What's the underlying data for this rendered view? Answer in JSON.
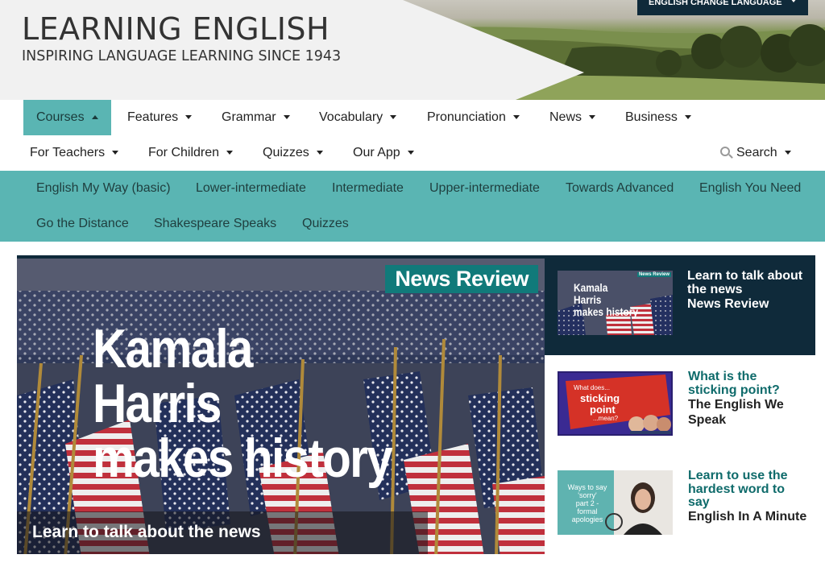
{
  "header": {
    "title": "LEARNING ENGLISH",
    "subtitle": "INSPIRING LANGUAGE LEARNING SINCE 1943",
    "language_button": "ENGLISH CHANGE LANGUAGE"
  },
  "nav": {
    "row1": [
      "Courses",
      "Features",
      "Grammar",
      "Vocabulary",
      "Pronunciation",
      "News",
      "Business"
    ],
    "row2": [
      "For Teachers",
      "For Children",
      "Quizzes",
      "Our App"
    ],
    "search": "Search"
  },
  "subnav": {
    "row1": [
      "English My Way (basic)",
      "Lower-intermediate",
      "Intermediate",
      "Upper-intermediate",
      "Towards Advanced",
      "English You Need"
    ],
    "row2": [
      "Go the Distance",
      "Shakespeare Speaks",
      "Quizzes"
    ]
  },
  "hero": {
    "badge": "News Review",
    "headline_lines": [
      "Kamala",
      "Harris",
      "makes history"
    ],
    "caption": "Learn to talk about the news"
  },
  "cards": [
    {
      "thumb_badge": "News Review",
      "thumb_text": [
        "Kamala",
        "Harris",
        "makes history"
      ],
      "title": "Learn to talk about the news",
      "subtitle": "News Review"
    },
    {
      "thumb_text": [
        "What does...",
        "sticking",
        "point",
        "...mean?"
      ],
      "title": "What is the sticking point?",
      "subtitle": "The English We Speak"
    },
    {
      "thumb_text": [
        "Ways to say",
        "'sorry'",
        "part 2 -",
        "formal",
        "apologies"
      ],
      "title": "Learn to use the hardest word to say",
      "subtitle": "English In A Minute"
    }
  ],
  "colors": {
    "teal": "#5ab5b3",
    "navy": "#0f2a3a",
    "badge_teal": "#117a7a",
    "card_title_teal": "#0f6b6b"
  }
}
